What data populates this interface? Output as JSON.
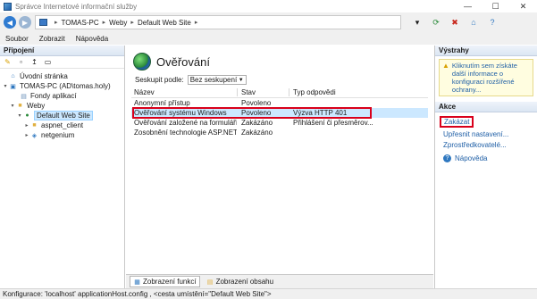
{
  "window": {
    "title": "Správce Internetové informační služby",
    "controls": [
      "—",
      "☐",
      "✕"
    ]
  },
  "address": {
    "segments": [
      "TOMAS-PC",
      "Weby",
      "Default Web Site"
    ],
    "separator": "▸"
  },
  "menu": [
    "Soubor",
    "Zobrazit",
    "Nápověda"
  ],
  "left": {
    "header": "Připojení",
    "tree": [
      {
        "label": "Úvodní stránka",
        "icon": "home-icon"
      },
      {
        "label": "TOMAS-PC (AD\\tomas.holy)",
        "icon": "server-icon"
      },
      {
        "label": "Fondy aplikací",
        "icon": "app-pool-icon"
      },
      {
        "label": "Weby",
        "icon": "folder-icon"
      },
      {
        "label": "Default Web Site",
        "icon": "globe-icon"
      },
      {
        "label": "aspnet_client",
        "icon": "folder-icon"
      },
      {
        "label": "netgenium",
        "icon": "app-icon"
      }
    ]
  },
  "center": {
    "title": "Ověřování",
    "groupby_label": "Seskupit podle:",
    "groupby_value": "Bez seskupení",
    "columns": [
      "Název",
      "Stav",
      "Typ odpovědi"
    ],
    "rows": [
      {
        "name": "Anonymní přístup",
        "state": "Povoleno",
        "type": ""
      },
      {
        "name": "Ověřování systému Windows",
        "state": "Povoleno",
        "type": "Výzva HTTP 401"
      },
      {
        "name": "Ověřování založené na formulářích",
        "state": "Zakázáno",
        "type": "Přihlášení či přesměrov..."
      },
      {
        "name": "Zosobnění technologie ASP.NET",
        "state": "Zakázáno",
        "type": ""
      }
    ],
    "tabs": [
      "Zobrazení funkcí",
      "Zobrazení obsahu"
    ]
  },
  "right": {
    "alerts_header": "Výstrahy",
    "alert_text": "Kliknutím sem získáte další informace o konfiguraci rozšířené ochrany...",
    "actions_header": "Akce",
    "actions": [
      "Zakázat",
      "Upřesnit nastavení...",
      "Zprostředkovatelé...",
      "Nápověda"
    ]
  },
  "status": {
    "text": "Konfigurace: 'localhost' applicationHost.config , <cesta umístění=\"Default Web Site\">"
  },
  "colors": {
    "highlight": "#cce8ff",
    "annotation_red": "#d9001b",
    "link_blue": "#1f5fa6"
  }
}
